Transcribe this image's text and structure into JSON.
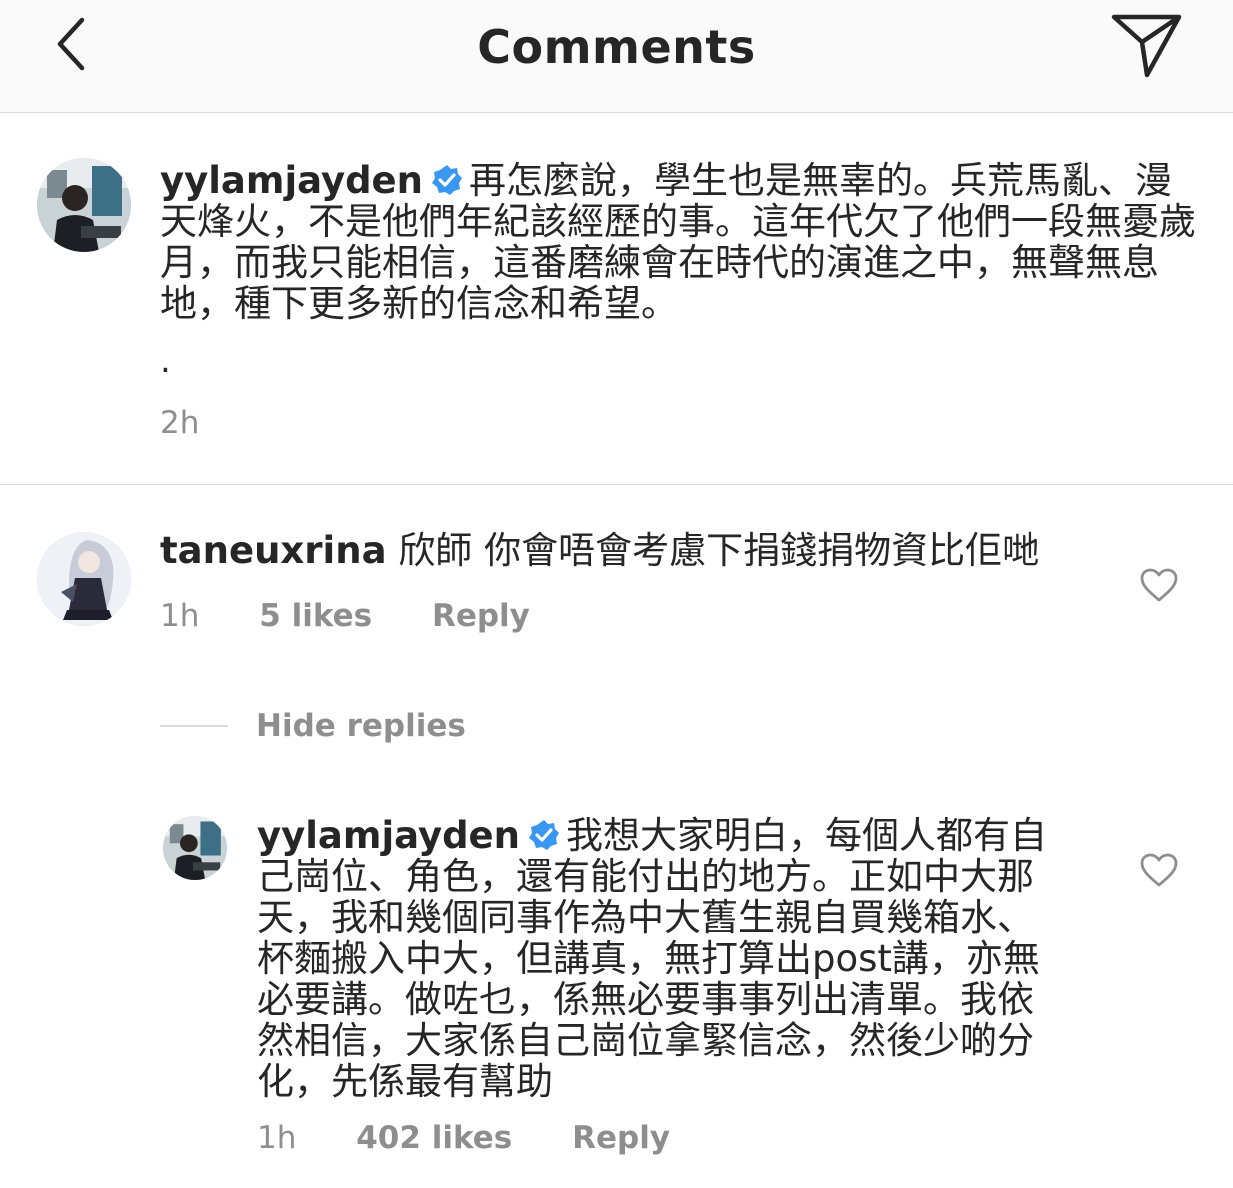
{
  "header": {
    "title": "Comments"
  },
  "caption": {
    "username": "yylamjayden",
    "text": "再怎麼說，學生也是無辜的。兵荒馬亂、漫天烽火，不是他們年紀該經歷的事。這年代欠了他們一段無憂歲月，而我只能相信，這番磨練會在時代的演進之中，無聲無息地，種下更多新的信念和希望。",
    "dot": ".",
    "time": "2h"
  },
  "comment": {
    "username": "taneuxrina",
    "text": "欣師 你會唔會考慮下捐錢捐物資比佢哋",
    "time": "1h",
    "likes": "5 likes",
    "reply": "Reply"
  },
  "hide_replies": "Hide replies",
  "reply_comment": {
    "username": "yylamjayden",
    "text": "我想大家明白，每個人都有自己崗位、角色，還有能付出的地方。正如中大那天，我和幾個同事作為中大舊生親自買幾箱水、杯麵搬入中大，但講真，無打算出post講，亦無必要講。做咗乜，係無必要事事列出清單。我依然相信，大家係自己崗位拿緊信念，然後少啲分化，先係最有幫助",
    "time": "1h",
    "likes": "402 likes",
    "reply": "Reply"
  },
  "icons": {
    "back": "chevron-left-icon",
    "share": "paper-plane-icon",
    "verified": "verified-badge-icon",
    "like": "heart-outline-icon"
  },
  "colors": {
    "verified": "#3897f0",
    "secondary_text": "#8e8e8e",
    "divider": "#dbdbdb"
  }
}
